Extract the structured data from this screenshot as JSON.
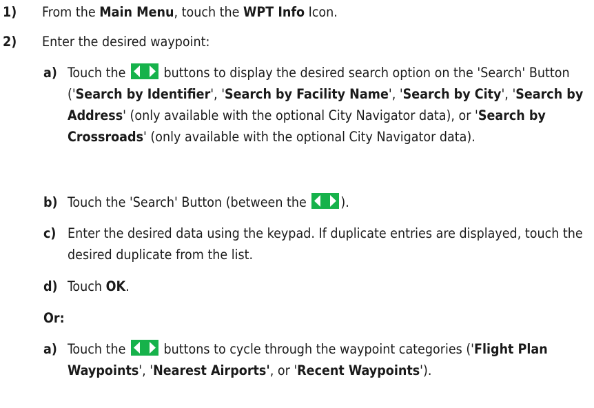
{
  "step1": {
    "num": "1)",
    "t1": "From the ",
    "b1": "Main Menu",
    "t2": ", touch the ",
    "b2": "WPT Info",
    "t3": " Icon."
  },
  "step2": {
    "num": "2)",
    "text": "Enter the desired waypoint:"
  },
  "a1": {
    "label": "a)",
    "t1": "Touch the ",
    "t2": " buttons to display the desired search option on the 'Search' Button ('",
    "b1": "Search by Identifier",
    "t3": "', '",
    "b2": "Search by Facility Name",
    "t4": "', '",
    "b3": "Search by City",
    "t5": "',  '",
    "b4": "Search by Address",
    "t6": "' (only available with the optional City Navigator data), or '",
    "b5": "Search by Crossroads",
    "t7": "' (only available with the optional City Navigator data)."
  },
  "b": {
    "label": "b)",
    "t1": "Touch the 'Search' Button (between the ",
    "t2": ")."
  },
  "c": {
    "label": "c)",
    "text": "Enter the desired data using the keypad.  If duplicate entries are displayed, touch the desired duplicate from the list."
  },
  "d": {
    "label": "d)",
    "t1": "Touch ",
    "b1": "OK",
    "t2": "."
  },
  "or_label": "Or:",
  "a2": {
    "label": "a)",
    "t1": "Touch the ",
    "t2": " buttons to cycle through the waypoint categories ('",
    "b1": "Flight Plan Waypoints",
    "t3": "', '",
    "b2": "Nearest Airports'",
    "t4": ", or '",
    "b3": "Recent Waypoints",
    "t5": "')."
  },
  "icons": {
    "arrows": "left-right-arrow-buttons-icon",
    "arrow_bg": "#16b24b",
    "arrow_fg": "#ffffff"
  }
}
